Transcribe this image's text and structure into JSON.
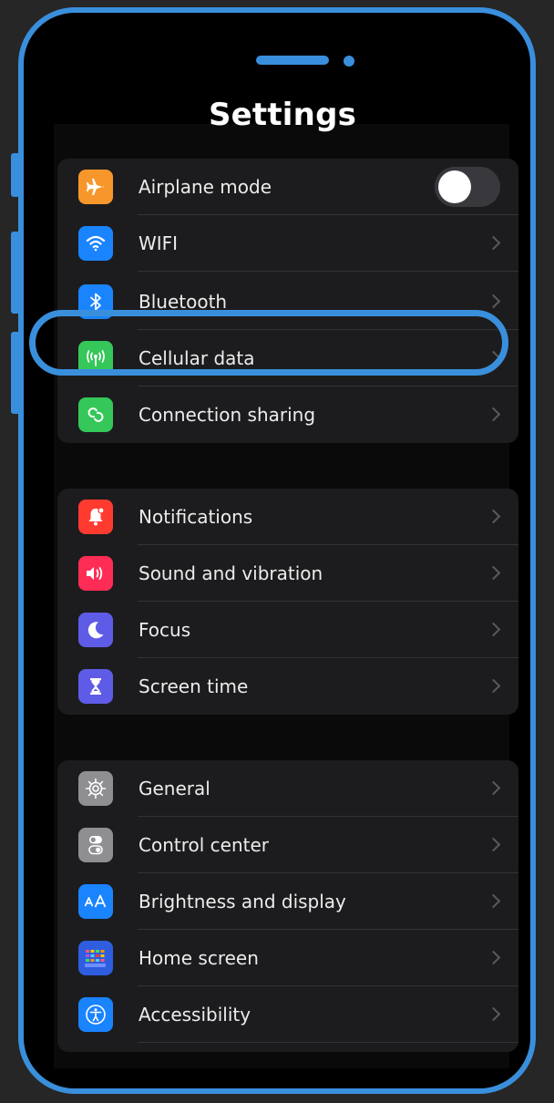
{
  "screen": {
    "title": "Settings"
  },
  "groups": [
    {
      "items": [
        {
          "label": "Airplane mode",
          "icon": "airplane-icon",
          "color": "#f7972b",
          "control": "toggle",
          "toggle_on": false
        },
        {
          "label": "WIFI",
          "icon": "wifi-icon",
          "color": "#1a84ff",
          "control": "chevron"
        },
        {
          "label": "Bluetooth",
          "icon": "bluetooth-icon",
          "color": "#1a84ff",
          "control": "chevron"
        },
        {
          "label": "Cellular data",
          "icon": "antenna-icon",
          "color": "#35c759",
          "control": "chevron",
          "highlighted": true
        },
        {
          "label": "Connection sharing",
          "icon": "link-icon",
          "color": "#35c759",
          "control": "chevron"
        }
      ]
    },
    {
      "items": [
        {
          "label": "Notifications",
          "icon": "bell-icon",
          "color": "#ff3b30",
          "control": "chevron"
        },
        {
          "label": "Sound and vibration",
          "icon": "speaker-icon",
          "color": "#ff2d55",
          "control": "chevron"
        },
        {
          "label": "Focus",
          "icon": "moon-icon",
          "color": "#5e5ce6",
          "control": "chevron"
        },
        {
          "label": "Screen time",
          "icon": "hourglass-icon",
          "color": "#5e5ce6",
          "control": "chevron"
        }
      ]
    },
    {
      "items": [
        {
          "label": "General",
          "icon": "gear-icon",
          "color": "#8e8e93",
          "control": "chevron"
        },
        {
          "label": "Control center",
          "icon": "switches-icon",
          "color": "#8e8e93",
          "control": "chevron"
        },
        {
          "label": "Brightness and display",
          "icon": "text-size-icon",
          "color": "#1a84ff",
          "control": "chevron"
        },
        {
          "label": "Home screen",
          "icon": "app-grid-icon",
          "color": "#2f5de0",
          "control": "chevron"
        },
        {
          "label": "Accessibility",
          "icon": "accessibility-icon",
          "color": "#1a84ff",
          "control": "chevron"
        }
      ]
    }
  ],
  "colors": {
    "accent": "#3a8fdc",
    "background": "#262626",
    "phone_screen": "#000000",
    "group_background": "#1c1c1e"
  }
}
